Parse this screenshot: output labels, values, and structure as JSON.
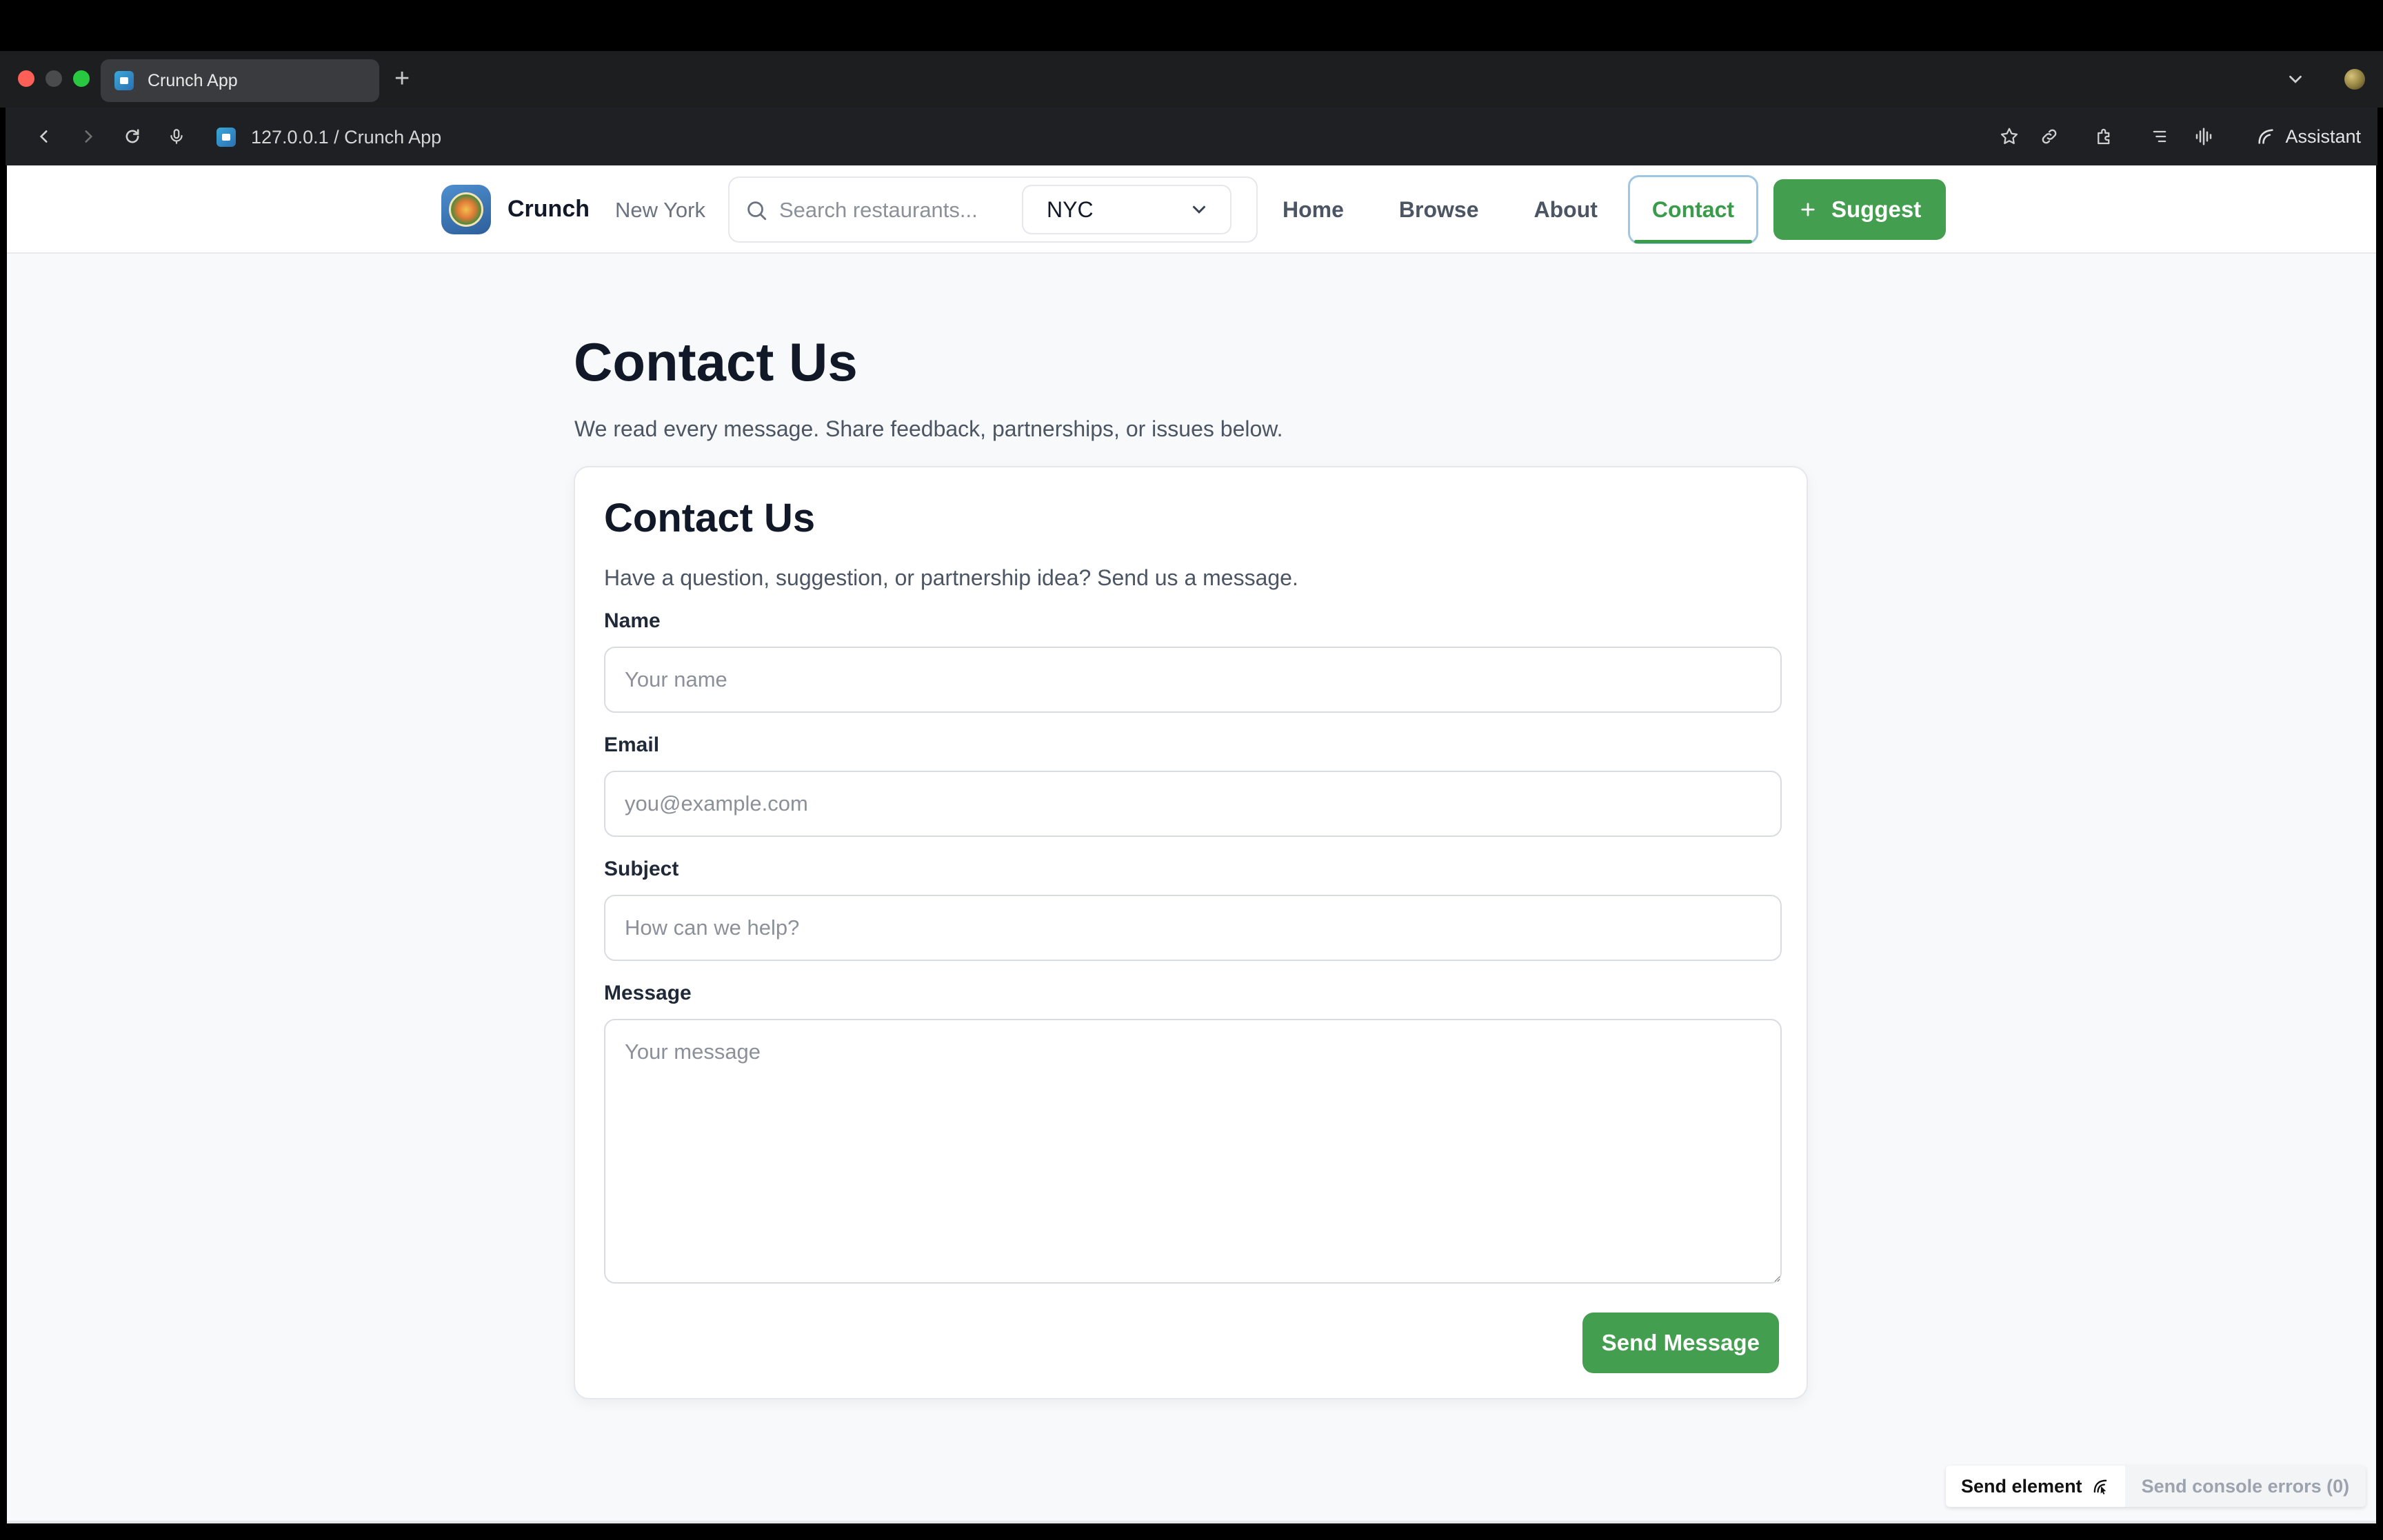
{
  "browser": {
    "tab_title": "Crunch App",
    "new_tab": "+",
    "url": "127.0.0.1 / Crunch App",
    "assistant_label": "Assistant"
  },
  "header": {
    "brand": "Crunch",
    "city_label": "New York",
    "search_placeholder": "Search restaurants...",
    "city_select_value": "NYC",
    "nav": {
      "home": "Home",
      "browse": "Browse",
      "about": "About",
      "contact": "Contact"
    },
    "suggest_label": "Suggest"
  },
  "page": {
    "title": "Contact Us",
    "subtitle": "We read every message. Share feedback, partnerships, or issues below."
  },
  "form": {
    "title": "Contact Us",
    "subtitle": "Have a question, suggestion, or partnership idea? Send us a message.",
    "name_label": "Name",
    "name_placeholder": "Your name",
    "email_label": "Email",
    "email_placeholder": "you@example.com",
    "subject_label": "Subject",
    "subject_placeholder": "How can we help?",
    "message_label": "Message",
    "message_placeholder": "Your message",
    "submit_label": "Send Message"
  },
  "devtools": {
    "send_element": "Send element",
    "send_console_errors": "Send console errors (0)"
  },
  "colors": {
    "accent": "#439e4f",
    "active_nav": "#3a9b4a",
    "page_bg": "#f8f9fa"
  }
}
